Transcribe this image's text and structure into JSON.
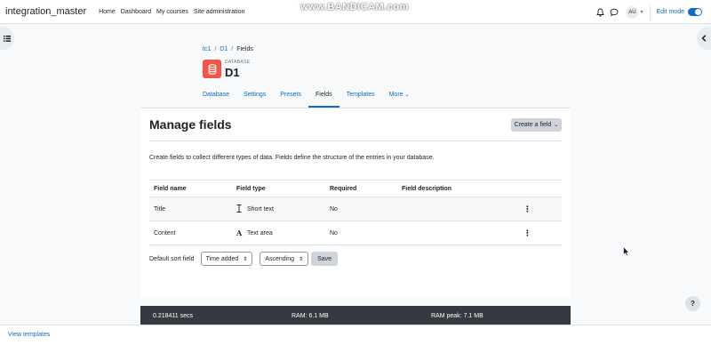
{
  "navbar": {
    "brand": "integration_master",
    "links": [
      "Home",
      "Dashboard",
      "My courses",
      "Site administration"
    ],
    "watermark": "www.BANDICAM.com",
    "avatar_initials": "AU",
    "edit_mode_label": "Edit mode",
    "edit_mode_on": true
  },
  "breadcrumb": {
    "items": [
      "tc1",
      "D1"
    ],
    "current": "Fields"
  },
  "activity": {
    "type_label": "DATABASE",
    "name": "D1",
    "icon_color": "#f0564a"
  },
  "secondary_nav": {
    "tabs": [
      "Database",
      "Settings",
      "Presets",
      "Fields",
      "Templates",
      "More"
    ],
    "active": "Fields"
  },
  "main": {
    "title": "Manage fields",
    "create_button": "Create a field",
    "intro": "Create fields to collect different types of data. Fields define the structure of the entries in your database.",
    "table": {
      "headers": [
        "Field name",
        "Field type",
        "Required",
        "Field description"
      ],
      "rows": [
        {
          "name": "Title",
          "type": "Short text",
          "type_icon": "text-cursor-icon",
          "required": "No",
          "description": ""
        },
        {
          "name": "Content",
          "type": "Text area",
          "type_icon": "font-a-icon",
          "required": "No",
          "description": ""
        }
      ]
    },
    "sort": {
      "label": "Default sort field",
      "field_value": "Time added",
      "direction_value": "Ascending",
      "save_label": "Save"
    }
  },
  "perf": {
    "time": "0.218411 secs",
    "ram": "RAM: 6.1 MB",
    "ram_peak": "RAM peak: 7.1 MB"
  },
  "help": "?",
  "bottom_bar": {
    "link": "View templates"
  },
  "colors": {
    "accent": "#0f6cbf",
    "footer_bg": "#343a40"
  }
}
